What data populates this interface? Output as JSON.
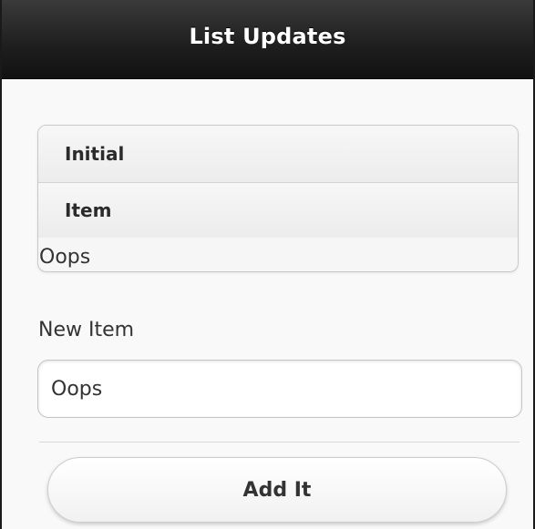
{
  "header": {
    "title": "List Updates"
  },
  "list": {
    "items": [
      {
        "label": "Initial"
      },
      {
        "label": "Item"
      }
    ],
    "plain_item": "Oops"
  },
  "form": {
    "new_item_label": "New Item",
    "new_item_value": "Oops",
    "add_button_label": "Add It"
  },
  "colors": {
    "header_background": "#1e1e1e",
    "header_text": "#ffffff",
    "page_background": "#f9f9f9"
  }
}
